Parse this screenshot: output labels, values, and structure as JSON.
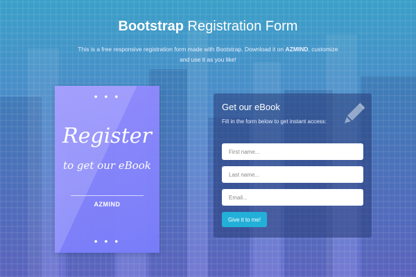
{
  "header": {
    "title_strong": "Bootstrap",
    "title_light": "Registration Form",
    "subtitle_pre": "This is a free responsive registration form made with Bootstrap. Download it on",
    "subtitle_brand": "AZMIND",
    "subtitle_post": ", customize and use it as you like!"
  },
  "card": {
    "dots": "• • •",
    "title": "Register",
    "subtitle": "to get our eBook",
    "brand": "AZMIND"
  },
  "form": {
    "title": "Get our eBook",
    "description": "Fill in the form below to get instant access:",
    "icon": "pencil-icon",
    "first_name_placeholder": "First name...",
    "last_name_placeholder": "Last name...",
    "email_placeholder": "Email...",
    "submit_label": "Give it to me!"
  },
  "colors": {
    "accent": "#23b0d8",
    "card": "#8a85f8",
    "bg_top": "#3aa0c8",
    "bg_bottom": "#6a6fcf"
  }
}
